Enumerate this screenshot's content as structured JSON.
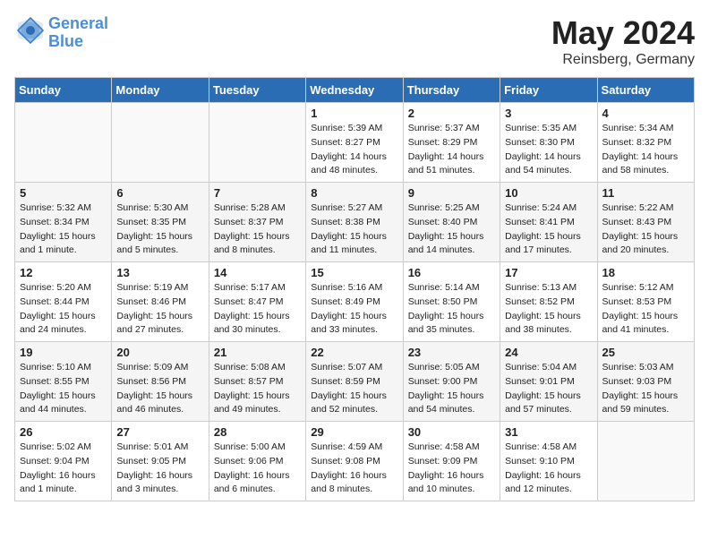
{
  "logo": {
    "line1": "General",
    "line2": "Blue"
  },
  "title": "May 2024",
  "location": "Reinsberg, Germany",
  "days_header": [
    "Sunday",
    "Monday",
    "Tuesday",
    "Wednesday",
    "Thursday",
    "Friday",
    "Saturday"
  ],
  "weeks": [
    [
      {
        "day": "",
        "sunrise": "",
        "sunset": "",
        "daylight": ""
      },
      {
        "day": "",
        "sunrise": "",
        "sunset": "",
        "daylight": ""
      },
      {
        "day": "",
        "sunrise": "",
        "sunset": "",
        "daylight": ""
      },
      {
        "day": "1",
        "sunrise": "Sunrise: 5:39 AM",
        "sunset": "Sunset: 8:27 PM",
        "daylight": "Daylight: 14 hours and 48 minutes."
      },
      {
        "day": "2",
        "sunrise": "Sunrise: 5:37 AM",
        "sunset": "Sunset: 8:29 PM",
        "daylight": "Daylight: 14 hours and 51 minutes."
      },
      {
        "day": "3",
        "sunrise": "Sunrise: 5:35 AM",
        "sunset": "Sunset: 8:30 PM",
        "daylight": "Daylight: 14 hours and 54 minutes."
      },
      {
        "day": "4",
        "sunrise": "Sunrise: 5:34 AM",
        "sunset": "Sunset: 8:32 PM",
        "daylight": "Daylight: 14 hours and 58 minutes."
      }
    ],
    [
      {
        "day": "5",
        "sunrise": "Sunrise: 5:32 AM",
        "sunset": "Sunset: 8:34 PM",
        "daylight": "Daylight: 15 hours and 1 minute."
      },
      {
        "day": "6",
        "sunrise": "Sunrise: 5:30 AM",
        "sunset": "Sunset: 8:35 PM",
        "daylight": "Daylight: 15 hours and 5 minutes."
      },
      {
        "day": "7",
        "sunrise": "Sunrise: 5:28 AM",
        "sunset": "Sunset: 8:37 PM",
        "daylight": "Daylight: 15 hours and 8 minutes."
      },
      {
        "day": "8",
        "sunrise": "Sunrise: 5:27 AM",
        "sunset": "Sunset: 8:38 PM",
        "daylight": "Daylight: 15 hours and 11 minutes."
      },
      {
        "day": "9",
        "sunrise": "Sunrise: 5:25 AM",
        "sunset": "Sunset: 8:40 PM",
        "daylight": "Daylight: 15 hours and 14 minutes."
      },
      {
        "day": "10",
        "sunrise": "Sunrise: 5:24 AM",
        "sunset": "Sunset: 8:41 PM",
        "daylight": "Daylight: 15 hours and 17 minutes."
      },
      {
        "day": "11",
        "sunrise": "Sunrise: 5:22 AM",
        "sunset": "Sunset: 8:43 PM",
        "daylight": "Daylight: 15 hours and 20 minutes."
      }
    ],
    [
      {
        "day": "12",
        "sunrise": "Sunrise: 5:20 AM",
        "sunset": "Sunset: 8:44 PM",
        "daylight": "Daylight: 15 hours and 24 minutes."
      },
      {
        "day": "13",
        "sunrise": "Sunrise: 5:19 AM",
        "sunset": "Sunset: 8:46 PM",
        "daylight": "Daylight: 15 hours and 27 minutes."
      },
      {
        "day": "14",
        "sunrise": "Sunrise: 5:17 AM",
        "sunset": "Sunset: 8:47 PM",
        "daylight": "Daylight: 15 hours and 30 minutes."
      },
      {
        "day": "15",
        "sunrise": "Sunrise: 5:16 AM",
        "sunset": "Sunset: 8:49 PM",
        "daylight": "Daylight: 15 hours and 33 minutes."
      },
      {
        "day": "16",
        "sunrise": "Sunrise: 5:14 AM",
        "sunset": "Sunset: 8:50 PM",
        "daylight": "Daylight: 15 hours and 35 minutes."
      },
      {
        "day": "17",
        "sunrise": "Sunrise: 5:13 AM",
        "sunset": "Sunset: 8:52 PM",
        "daylight": "Daylight: 15 hours and 38 minutes."
      },
      {
        "day": "18",
        "sunrise": "Sunrise: 5:12 AM",
        "sunset": "Sunset: 8:53 PM",
        "daylight": "Daylight: 15 hours and 41 minutes."
      }
    ],
    [
      {
        "day": "19",
        "sunrise": "Sunrise: 5:10 AM",
        "sunset": "Sunset: 8:55 PM",
        "daylight": "Daylight: 15 hours and 44 minutes."
      },
      {
        "day": "20",
        "sunrise": "Sunrise: 5:09 AM",
        "sunset": "Sunset: 8:56 PM",
        "daylight": "Daylight: 15 hours and 46 minutes."
      },
      {
        "day": "21",
        "sunrise": "Sunrise: 5:08 AM",
        "sunset": "Sunset: 8:57 PM",
        "daylight": "Daylight: 15 hours and 49 minutes."
      },
      {
        "day": "22",
        "sunrise": "Sunrise: 5:07 AM",
        "sunset": "Sunset: 8:59 PM",
        "daylight": "Daylight: 15 hours and 52 minutes."
      },
      {
        "day": "23",
        "sunrise": "Sunrise: 5:05 AM",
        "sunset": "Sunset: 9:00 PM",
        "daylight": "Daylight: 15 hours and 54 minutes."
      },
      {
        "day": "24",
        "sunrise": "Sunrise: 5:04 AM",
        "sunset": "Sunset: 9:01 PM",
        "daylight": "Daylight: 15 hours and 57 minutes."
      },
      {
        "day": "25",
        "sunrise": "Sunrise: 5:03 AM",
        "sunset": "Sunset: 9:03 PM",
        "daylight": "Daylight: 15 hours and 59 minutes."
      }
    ],
    [
      {
        "day": "26",
        "sunrise": "Sunrise: 5:02 AM",
        "sunset": "Sunset: 9:04 PM",
        "daylight": "Daylight: 16 hours and 1 minute."
      },
      {
        "day": "27",
        "sunrise": "Sunrise: 5:01 AM",
        "sunset": "Sunset: 9:05 PM",
        "daylight": "Daylight: 16 hours and 3 minutes."
      },
      {
        "day": "28",
        "sunrise": "Sunrise: 5:00 AM",
        "sunset": "Sunset: 9:06 PM",
        "daylight": "Daylight: 16 hours and 6 minutes."
      },
      {
        "day": "29",
        "sunrise": "Sunrise: 4:59 AM",
        "sunset": "Sunset: 9:08 PM",
        "daylight": "Daylight: 16 hours and 8 minutes."
      },
      {
        "day": "30",
        "sunrise": "Sunrise: 4:58 AM",
        "sunset": "Sunset: 9:09 PM",
        "daylight": "Daylight: 16 hours and 10 minutes."
      },
      {
        "day": "31",
        "sunrise": "Sunrise: 4:58 AM",
        "sunset": "Sunset: 9:10 PM",
        "daylight": "Daylight: 16 hours and 12 minutes."
      },
      {
        "day": "",
        "sunrise": "",
        "sunset": "",
        "daylight": ""
      }
    ]
  ]
}
